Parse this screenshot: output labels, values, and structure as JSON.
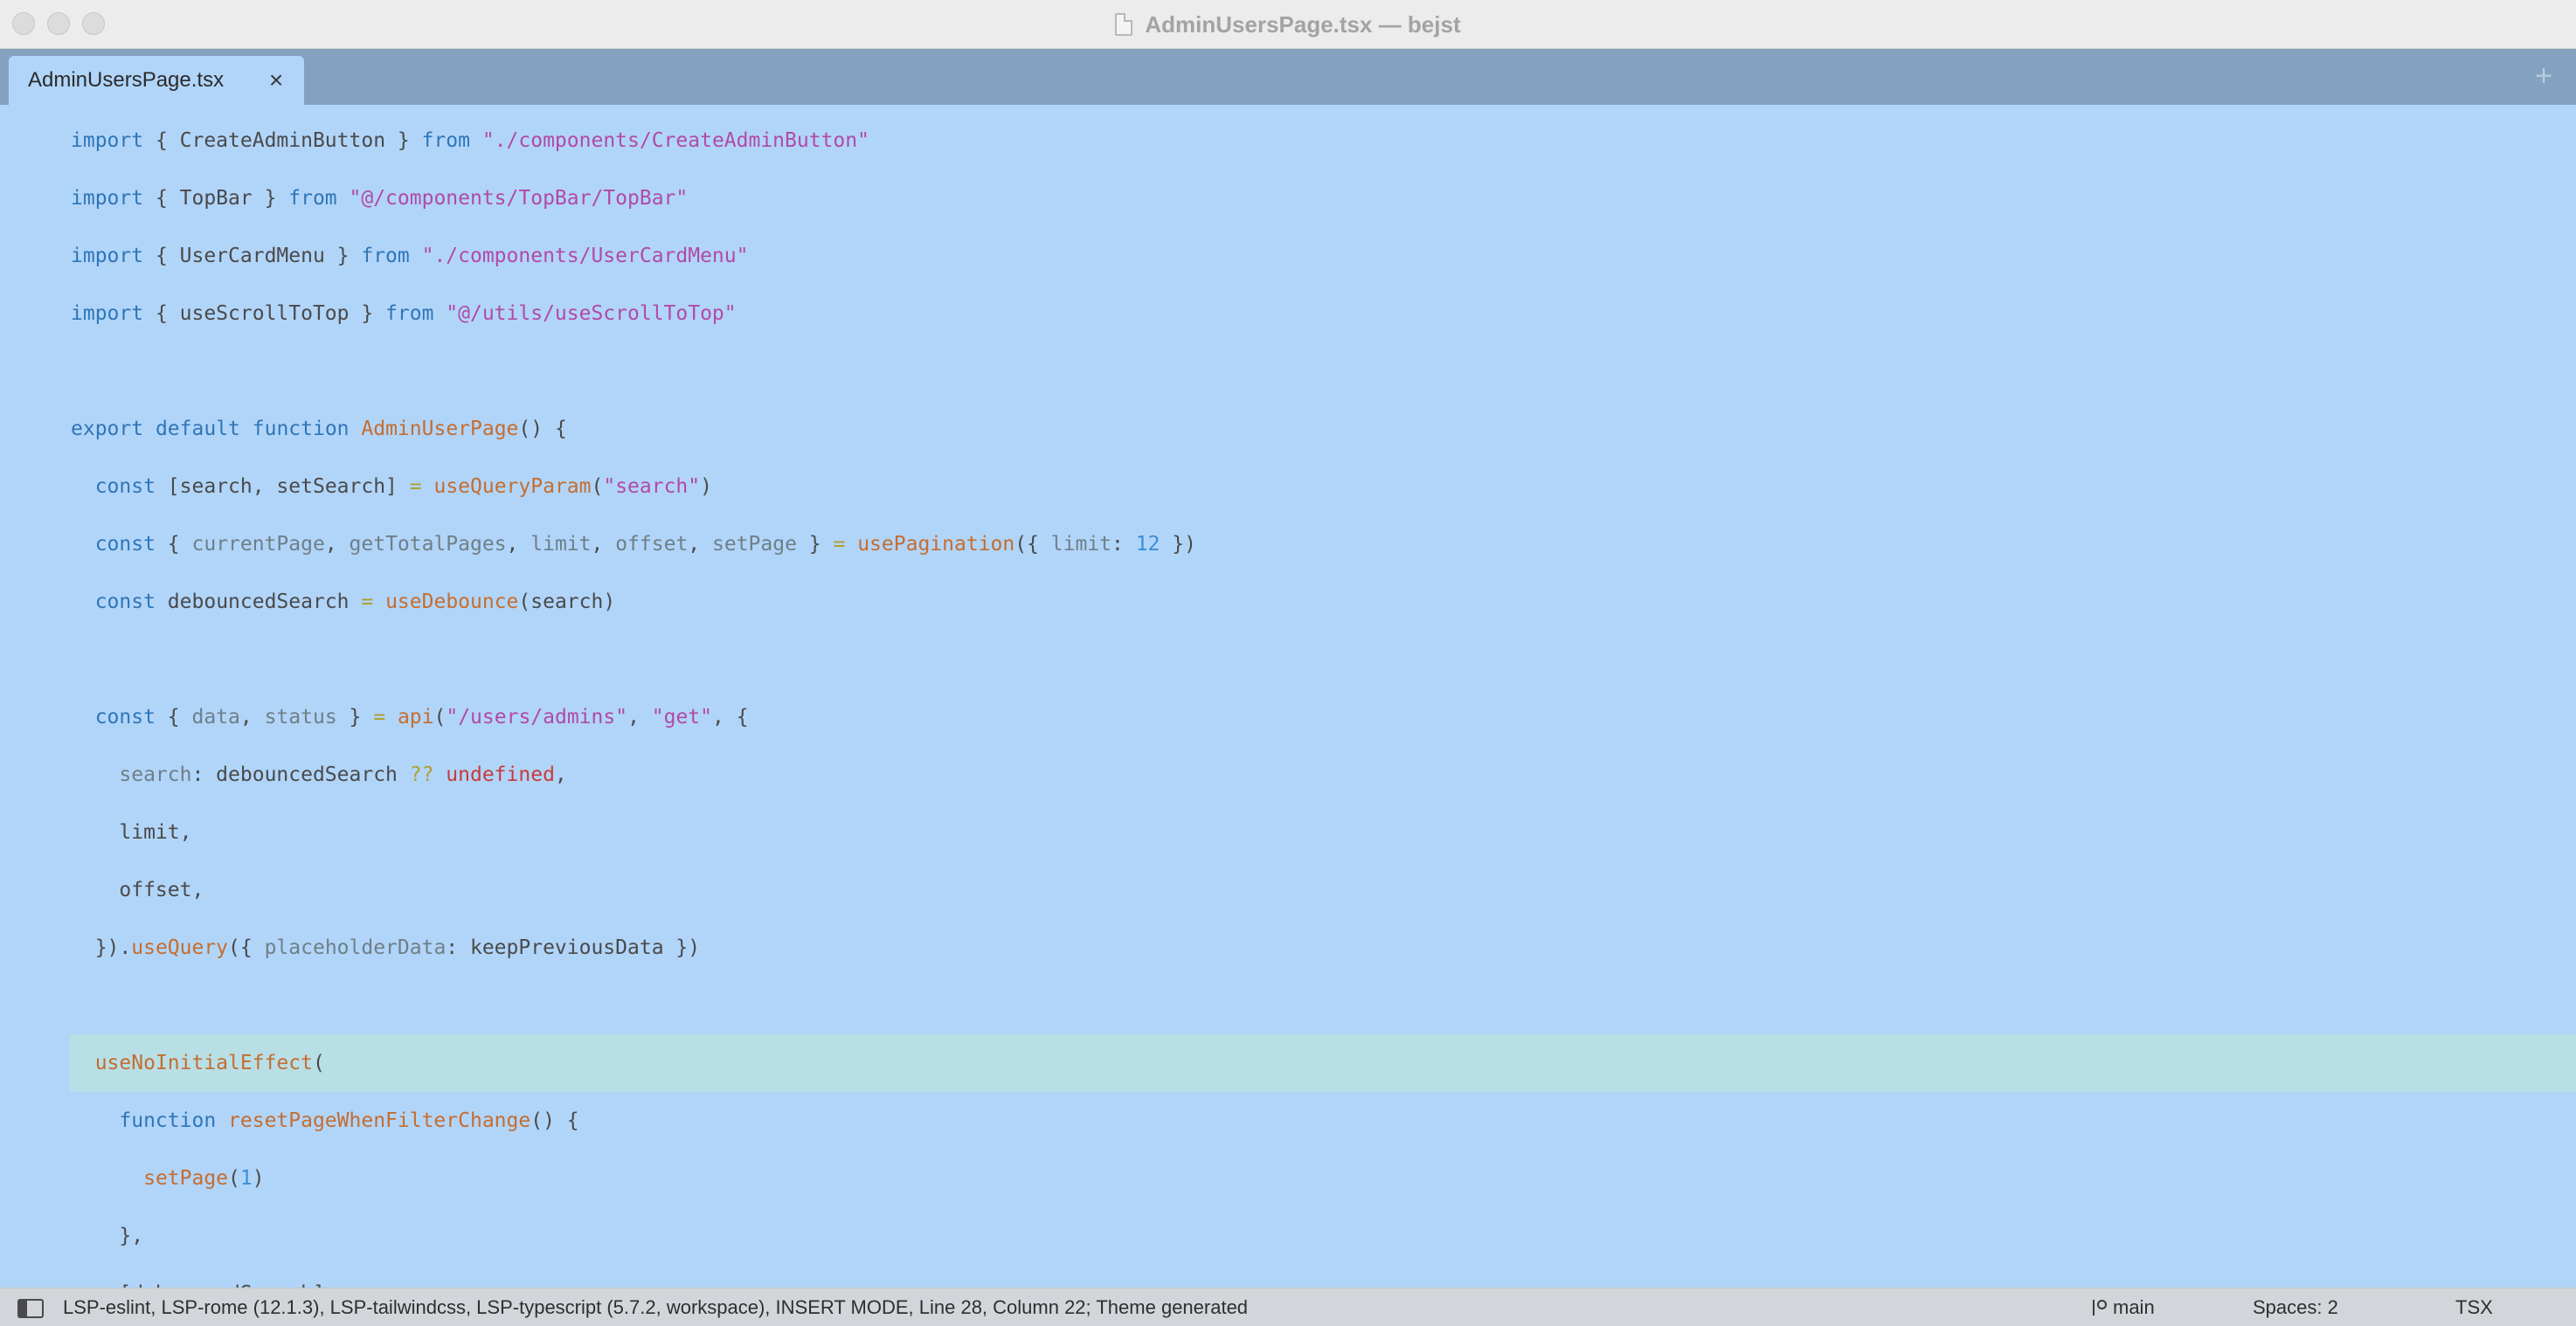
{
  "window": {
    "title": "AdminUsersPage.tsx — bejst"
  },
  "tabs": [
    {
      "label": "AdminUsersPage.tsx",
      "close": "×"
    }
  ],
  "new_tab": "+",
  "code_lines": [
    [
      [
        "k",
        "import"
      ],
      [
        "v",
        " { CreateAdminButton } "
      ],
      [
        "k",
        "from"
      ],
      [
        "v",
        " "
      ],
      [
        "s",
        "\"./components/CreateAdminButton\""
      ]
    ],
    [
      [
        "k",
        "import"
      ],
      [
        "v",
        " { TopBar } "
      ],
      [
        "k",
        "from"
      ],
      [
        "v",
        " "
      ],
      [
        "s",
        "\"@/components/TopBar/TopBar\""
      ]
    ],
    [
      [
        "k",
        "import"
      ],
      [
        "v",
        " { UserCardMenu } "
      ],
      [
        "k",
        "from"
      ],
      [
        "v",
        " "
      ],
      [
        "s",
        "\"./components/UserCardMenu\""
      ]
    ],
    [
      [
        "k",
        "import"
      ],
      [
        "v",
        " { useScrollToTop } "
      ],
      [
        "k",
        "from"
      ],
      [
        "v",
        " "
      ],
      [
        "s",
        "\"@/utils/useScrollToTop\""
      ]
    ],
    [],
    [
      [
        "k",
        "export"
      ],
      [
        "v",
        " "
      ],
      [
        "k",
        "default"
      ],
      [
        "v",
        " "
      ],
      [
        "k",
        "function"
      ],
      [
        "v",
        " "
      ],
      [
        "f",
        "AdminUserPage"
      ],
      [
        "v",
        "() {"
      ]
    ],
    [
      [
        "v",
        "  "
      ],
      [
        "k",
        "const"
      ],
      [
        "v",
        " [search, setSearch] "
      ],
      [
        "o",
        "="
      ],
      [
        "v",
        " "
      ],
      [
        "f",
        "useQueryParam"
      ],
      [
        "v",
        "("
      ],
      [
        "s",
        "\"search\""
      ],
      [
        "v",
        ")"
      ]
    ],
    [
      [
        "v",
        "  "
      ],
      [
        "k",
        "const"
      ],
      [
        "v",
        " { "
      ],
      [
        "p",
        "currentPage"
      ],
      [
        "v",
        ", "
      ],
      [
        "p",
        "getTotalPages"
      ],
      [
        "v",
        ", "
      ],
      [
        "p",
        "limit"
      ],
      [
        "v",
        ", "
      ],
      [
        "p",
        "offset"
      ],
      [
        "v",
        ", "
      ],
      [
        "p",
        "setPage"
      ],
      [
        "v",
        " } "
      ],
      [
        "o",
        "="
      ],
      [
        "v",
        " "
      ],
      [
        "f",
        "usePagination"
      ],
      [
        "v",
        "({ "
      ],
      [
        "p",
        "limit"
      ],
      [
        "v",
        ": "
      ],
      [
        "n",
        "12"
      ],
      [
        "v",
        " })"
      ]
    ],
    [
      [
        "v",
        "  "
      ],
      [
        "k",
        "const"
      ],
      [
        "v",
        " debouncedSearch "
      ],
      [
        "o",
        "="
      ],
      [
        "v",
        " "
      ],
      [
        "f",
        "useDebounce"
      ],
      [
        "v",
        "(search)"
      ]
    ],
    [],
    [
      [
        "v",
        "  "
      ],
      [
        "k",
        "const"
      ],
      [
        "v",
        " { "
      ],
      [
        "p",
        "data"
      ],
      [
        "v",
        ", "
      ],
      [
        "p",
        "status"
      ],
      [
        "v",
        " } "
      ],
      [
        "o",
        "="
      ],
      [
        "v",
        " "
      ],
      [
        "f",
        "api"
      ],
      [
        "v",
        "("
      ],
      [
        "s",
        "\"/users/admins\""
      ],
      [
        "v",
        ", "
      ],
      [
        "s",
        "\"get\""
      ],
      [
        "v",
        ", {"
      ]
    ],
    [
      [
        "v",
        "    "
      ],
      [
        "p",
        "search"
      ],
      [
        "v",
        ": debouncedSearch "
      ],
      [
        "o",
        "??"
      ],
      [
        "v",
        " "
      ],
      [
        "u",
        "undefined"
      ],
      [
        "v",
        ","
      ]
    ],
    [
      [
        "v",
        "    limit,"
      ]
    ],
    [
      [
        "v",
        "    offset,"
      ]
    ],
    [
      [
        "v",
        "  })."
      ],
      [
        "f",
        "useQuery"
      ],
      [
        "v",
        "({ "
      ],
      [
        "p",
        "placeholderData"
      ],
      [
        "v",
        ": keepPreviousData })"
      ]
    ],
    [],
    [
      [
        "v",
        "  "
      ],
      [
        "f",
        "useNoInitialEffect"
      ],
      [
        "v",
        "("
      ]
    ],
    [
      [
        "v",
        "    "
      ],
      [
        "k",
        "function"
      ],
      [
        "v",
        " "
      ],
      [
        "f",
        "resetPageWhenFilterChange"
      ],
      [
        "v",
        "() {"
      ]
    ],
    [
      [
        "v",
        "      "
      ],
      [
        "f",
        "setPage"
      ],
      [
        "v",
        "("
      ],
      [
        "n",
        "1"
      ],
      [
        "v",
        ")"
      ]
    ],
    [
      [
        "v",
        "    },"
      ]
    ],
    [
      [
        "v",
        "    [debouncedSearch],"
      ]
    ]
  ],
  "current_line_index": 16,
  "status": {
    "text": "LSP-eslint, LSP-rome (12.1.3), LSP-tailwindcss, LSP-typescript (5.7.2, workspace), INSERT MODE, Line 28, Column 22; Theme generated",
    "branch": "main",
    "spaces": "Spaces: 2",
    "language": "TSX"
  }
}
